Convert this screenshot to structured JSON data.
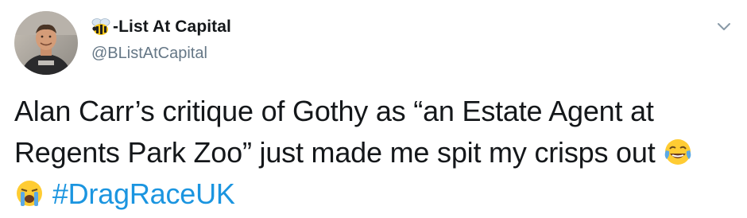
{
  "tweet": {
    "display_name": "-List At Capital",
    "name_prefix_icon": "bee-icon",
    "handle": "@BListAtCapital",
    "text_line1": "Alan Carr’s critique of Gothy as “an Estate Agent at",
    "text_line2": "Regents Park Zoo” just made me spit my crisps out",
    "emoji_1": "face-with-tears-of-joy-icon",
    "emoji_2": "loudly-crying-face-icon",
    "hashtag": "#DragRaceUK",
    "colors": {
      "text": "#14171a",
      "handle": "#657786",
      "hashtag": "#1b95e0",
      "caret": "#8899a6"
    }
  }
}
